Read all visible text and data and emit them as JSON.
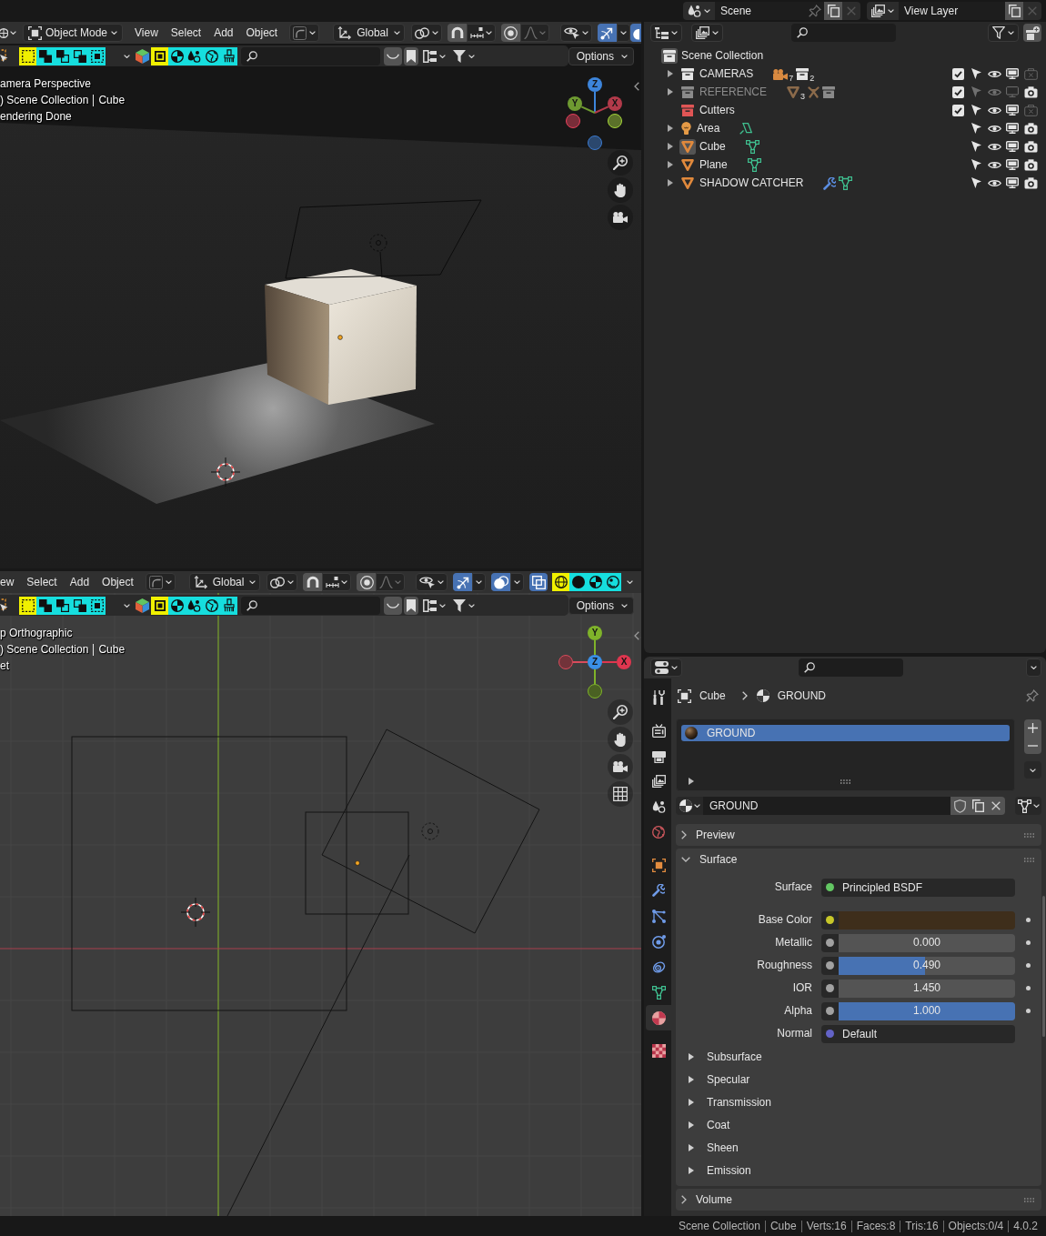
{
  "top_bar": {
    "scene": {
      "name": "Scene"
    },
    "view_layer": {
      "name": "View Layer"
    }
  },
  "viewports": [
    {
      "kind": "perspective",
      "header": [
        {
          "kind": "editor"
        },
        {
          "kind": "mode",
          "label": "Object Mode"
        },
        {
          "kind": "menu",
          "label": "View"
        },
        {
          "kind": "menu",
          "label": "Select"
        },
        {
          "kind": "menu",
          "label": "Add"
        },
        {
          "kind": "menu",
          "label": "Object"
        },
        {
          "kind": "object_gizmo"
        },
        {
          "kind": "orientation",
          "label": "Global"
        },
        {
          "kind": "pivot"
        },
        {
          "kind": "snap",
          "on": false
        },
        {
          "kind": "proportional",
          "on": false
        },
        {
          "kind": "visibility"
        },
        {
          "kind": "gizmos",
          "on": true
        },
        {
          "kind": "overlays",
          "on": true
        }
      ],
      "toolbar": {
        "select_modes": [
          {
            "kind": "set",
            "selected": true
          },
          {
            "kind": "extend",
            "selected": false
          },
          {
            "kind": "subtract",
            "selected": false
          },
          {
            "kind": "invert",
            "selected": false
          },
          {
            "kind": "intersect",
            "selected": false
          }
        ],
        "filters": [
          {
            "kind": "object",
            "selected": true
          },
          {
            "kind": "material",
            "selected": false
          },
          {
            "kind": "scene",
            "selected": false
          },
          {
            "kind": "world",
            "selected": false
          },
          {
            "kind": "brush",
            "selected": false
          }
        ],
        "toggles": [
          {
            "kind": "arc",
            "on": false
          },
          {
            "kind": "bookmark",
            "on": false
          }
        ],
        "options": "Options"
      },
      "overlay": {
        "view": "amera Perspective",
        "context": [
          ") Scene Collection",
          "Cube"
        ],
        "info": "endering Done"
      },
      "gizmo": [
        {
          "kind": "z_pos",
          "label": "Z",
          "color": "#3d85db"
        },
        {
          "kind": "y_pos",
          "label": "Y",
          "color": "#6e9a31"
        },
        {
          "kind": "x_pos",
          "label": "X",
          "color": "#b23a4a"
        },
        {
          "kind": "x_neg",
          "color": "#e8405a"
        },
        {
          "kind": "y_neg",
          "color": "#a6d639"
        },
        {
          "kind": "z_neg",
          "color": "#3b7bd0"
        }
      ]
    },
    {
      "kind": "top",
      "header": [
        {
          "kind": "menu",
          "label": "ew"
        },
        {
          "kind": "menu",
          "label": "Select"
        },
        {
          "kind": "menu",
          "label": "Add"
        },
        {
          "kind": "menu",
          "label": "Object"
        },
        {
          "kind": "object_gizmo"
        },
        {
          "kind": "orientation",
          "label": "Global"
        },
        {
          "kind": "pivot"
        },
        {
          "kind": "snap",
          "on": false
        },
        {
          "kind": "proportional",
          "on": false
        },
        {
          "kind": "visibility"
        },
        {
          "kind": "gizmos",
          "on": true
        },
        {
          "kind": "overlays",
          "on": true
        },
        {
          "kind": "xray",
          "on": true
        },
        {
          "kind": "shading",
          "modes": [
            {
              "kind": "wireframe",
              "selected": true
            },
            {
              "kind": "solid",
              "selected": false
            },
            {
              "kind": "material",
              "selected": false
            },
            {
              "kind": "rendered",
              "selected": false
            }
          ]
        }
      ],
      "toolbar": {
        "select_modes": [
          {
            "kind": "set",
            "selected": true
          },
          {
            "kind": "extend",
            "selected": false
          },
          {
            "kind": "subtract",
            "selected": false
          },
          {
            "kind": "invert",
            "selected": false
          },
          {
            "kind": "intersect",
            "selected": false
          }
        ],
        "filters": [
          {
            "kind": "object",
            "selected": true
          },
          {
            "kind": "material",
            "selected": false
          },
          {
            "kind": "scene",
            "selected": false
          },
          {
            "kind": "world",
            "selected": false
          },
          {
            "kind": "brush",
            "selected": false
          }
        ],
        "toggles": [
          {
            "kind": "arc",
            "on": false
          },
          {
            "kind": "bookmark",
            "on": false
          }
        ],
        "options": "Options"
      },
      "overlay": {
        "view": "p Orthographic",
        "context": [
          ") Scene Collection",
          "Cube"
        ],
        "info": "et"
      },
      "gizmo": [
        {
          "kind": "y_pos",
          "label": "Y",
          "color": "#7fb32a"
        },
        {
          "kind": "x_neg",
          "color": "#d94c5c"
        },
        {
          "kind": "z_pos",
          "label": "Z",
          "color": "#3a8fe6"
        },
        {
          "kind": "x_pos",
          "label": "X",
          "color": "#e0364f"
        },
        {
          "kind": "y_neg",
          "color": "#7fb32a"
        }
      ]
    }
  ],
  "outliner": {
    "root": {
      "name": "Scene Collection",
      "active": true
    },
    "rows": [
      {
        "kind": "collection",
        "name": "CAMERAS",
        "expandable": true,
        "dimmed": false,
        "active": false,
        "contents": [
          {
            "kind": "camera",
            "count": "7"
          },
          {
            "kind": "collection",
            "count": "2"
          }
        ],
        "included": true,
        "selectable": true,
        "viewport": true,
        "render": false
      },
      {
        "kind": "collection",
        "name": "REFERENCE",
        "expandable": true,
        "dimmed": true,
        "active": false,
        "contents": [
          {
            "kind": "mesh",
            "count": "3"
          },
          {
            "kind": "armature"
          },
          {
            "kind": "collection"
          }
        ],
        "included": true,
        "selectable": false,
        "viewport": false,
        "render": true
      },
      {
        "kind": "collection",
        "name": "Cutters",
        "color": "#e05555",
        "expandable": false,
        "dimmed": false,
        "active": false,
        "included": true,
        "selectable": true,
        "viewport": true,
        "render": false
      },
      {
        "kind": "light",
        "name": "Area",
        "expandable": true,
        "dimmed": false,
        "active": false,
        "contents": [
          {
            "kind": "light_data"
          }
        ],
        "selectable": true,
        "viewport": true,
        "render": true
      },
      {
        "kind": "mesh",
        "name": "Cube",
        "expandable": true,
        "dimmed": false,
        "active": true,
        "contents": [
          {
            "kind": "mesh_data"
          }
        ],
        "selectable": true,
        "viewport": true,
        "render": true
      },
      {
        "kind": "mesh",
        "name": "Plane",
        "expandable": true,
        "dimmed": false,
        "active": false,
        "contents": [
          {
            "kind": "mesh_data"
          }
        ],
        "selectable": true,
        "viewport": true,
        "render": true
      },
      {
        "kind": "mesh",
        "name": "SHADOW CATCHER",
        "expandable": true,
        "dimmed": false,
        "active": false,
        "contents": [
          {
            "kind": "modifier"
          },
          {
            "kind": "mesh_data"
          }
        ],
        "selectable": true,
        "viewport": true,
        "render": true
      }
    ]
  },
  "properties": {
    "tabs": [
      {
        "kind": "tool",
        "selected": false
      },
      {
        "kind": "render",
        "selected": false
      },
      {
        "kind": "output",
        "selected": false
      },
      {
        "kind": "view_layer",
        "selected": false
      },
      {
        "kind": "scene",
        "selected": false
      },
      {
        "kind": "world",
        "selected": false
      },
      {
        "kind": "object",
        "selected": false
      },
      {
        "kind": "modifiers",
        "selected": false
      },
      {
        "kind": "particles",
        "selected": false
      },
      {
        "kind": "physics",
        "selected": false
      },
      {
        "kind": "constraints",
        "selected": false
      },
      {
        "kind": "data",
        "selected": false
      },
      {
        "kind": "material",
        "selected": true
      },
      {
        "kind": "texture",
        "selected": false
      }
    ],
    "breadcrumb": [
      {
        "kind": "object",
        "name": "Cube"
      },
      {
        "kind": "material",
        "name": "GROUND"
      }
    ],
    "slots": [
      {
        "name": "GROUND",
        "selected": true
      }
    ],
    "material": {
      "name": "GROUND"
    },
    "panels": [
      {
        "title": "Preview",
        "expanded": false
      },
      {
        "title": "Surface",
        "expanded": true,
        "shader": {
          "kind": "menu",
          "label": "Surface",
          "value": "Principled BSDF",
          "socket": {
            "color": "#63c763"
          },
          "decorator": false
        },
        "inputs": [
          {
            "kind": "color",
            "label": "Base Color",
            "socket": {
              "color": "#c7c729"
            },
            "swatch": {
              "color": "#3e2e1b"
            },
            "decorator": true
          },
          {
            "kind": "slider",
            "label": "Metallic",
            "value": "0.000",
            "level": 0,
            "socket": {
              "color": "#a1a1a1"
            },
            "decorator": true
          },
          {
            "kind": "slider",
            "label": "Roughness",
            "value": "0.490",
            "level": 0.49,
            "socket": {
              "color": "#a1a1a1"
            },
            "decorator": true
          },
          {
            "kind": "number",
            "label": "IOR",
            "value": "1.450",
            "socket": {
              "color": "#a1a1a1"
            },
            "decorator": true
          },
          {
            "kind": "slider",
            "label": "Alpha",
            "value": "1.000",
            "level": 1,
            "socket": {
              "color": "#a1a1a1"
            },
            "decorator": true
          },
          {
            "kind": "menu",
            "label": "Normal",
            "value": "Default",
            "socket": {
              "color": "#6363c7"
            },
            "decorator": false
          }
        ],
        "subpanels": [
          {
            "title": "Subsurface",
            "expanded": false
          },
          {
            "title": "Specular",
            "expanded": false
          },
          {
            "title": "Transmission",
            "expanded": false
          },
          {
            "title": "Coat",
            "expanded": false
          },
          {
            "title": "Sheen",
            "expanded": false
          },
          {
            "title": "Emission",
            "expanded": false
          }
        ]
      },
      {
        "title": "Volume",
        "expanded": false
      }
    ]
  },
  "status_bar": [
    "Scene Collection",
    "Cube",
    "Verts:16",
    "Faces:8",
    "Tris:16",
    "Objects:0/4",
    "4.0.2"
  ]
}
